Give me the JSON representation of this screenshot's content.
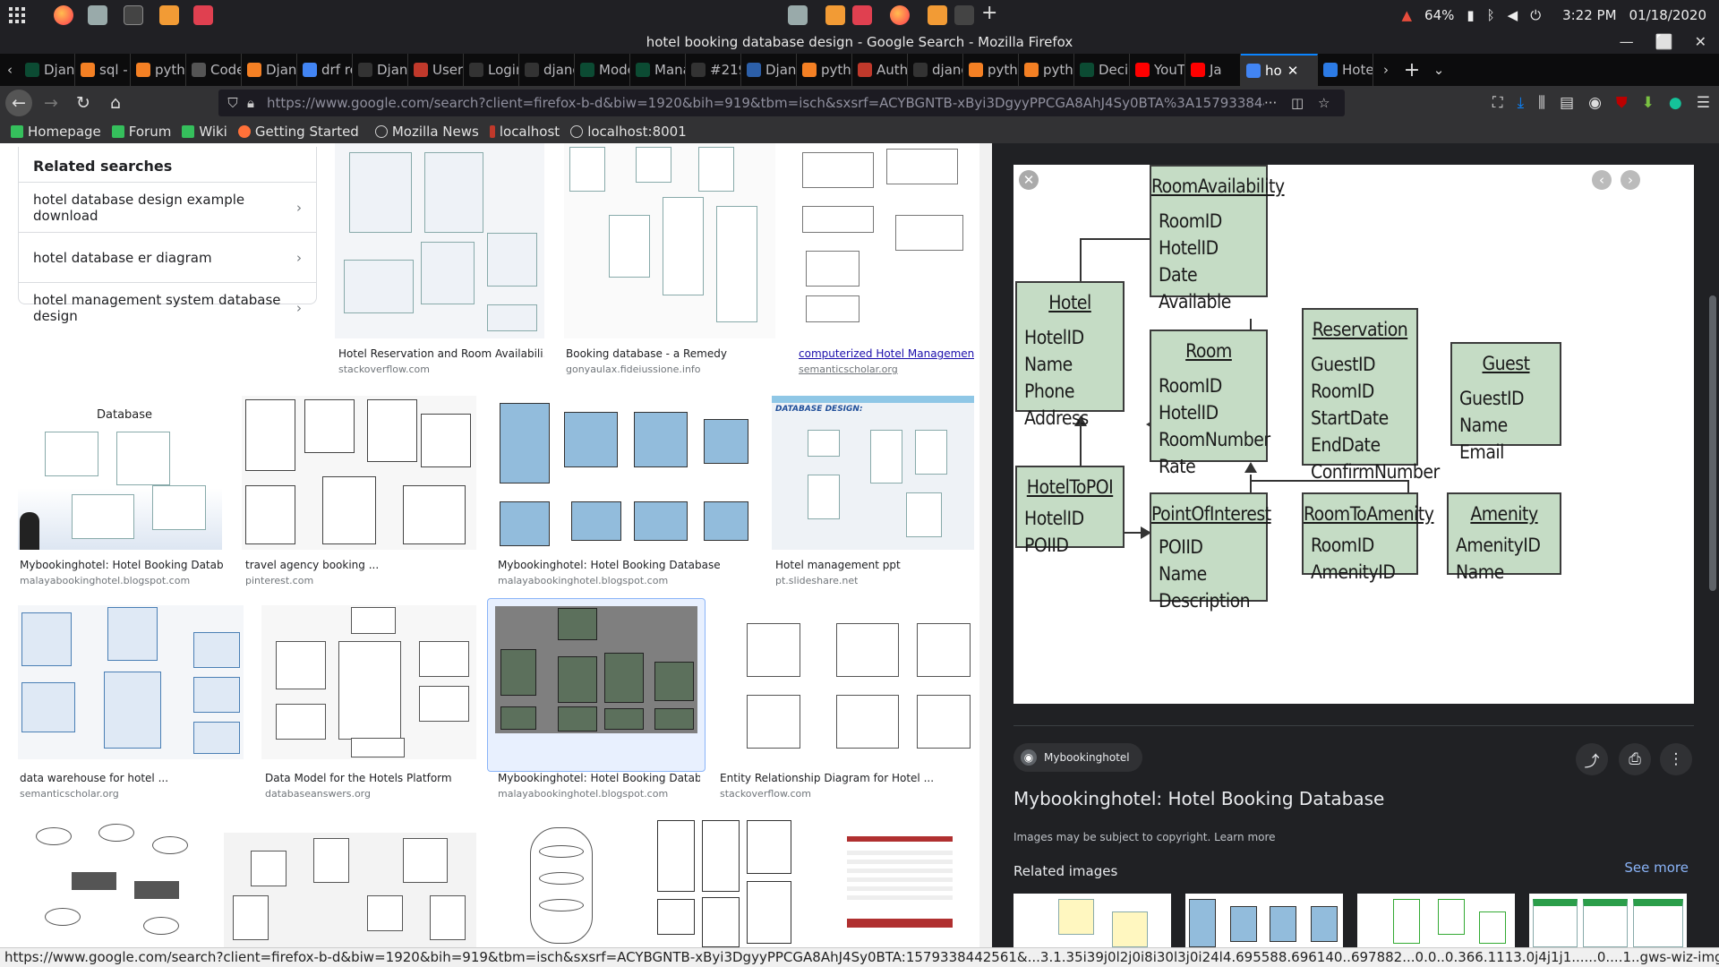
{
  "system": {
    "battery": "64%",
    "time": "3:22 PM",
    "date": "01/18/2020"
  },
  "window": {
    "title": "hotel booking database design - Google Search - Mozilla Firefox"
  },
  "tabs": [
    {
      "label": "Djan",
      "color": "#0c4b33"
    },
    {
      "label": "sql -",
      "color": "#f48024"
    },
    {
      "label": "pytho",
      "color": "#f48024"
    },
    {
      "label": "Code",
      "color": "#555"
    },
    {
      "label": "Djang",
      "color": "#f48024"
    },
    {
      "label": "drf re",
      "color": "#4285f4"
    },
    {
      "label": "Djang",
      "color": "#333"
    },
    {
      "label": "User",
      "color": "#c0392b"
    },
    {
      "label": "Login –",
      "color": "#333"
    },
    {
      "label": "django.c",
      "color": "#333"
    },
    {
      "label": "Mode",
      "color": "#0c4b33"
    },
    {
      "label": "Mana",
      "color": "#0c4b33"
    },
    {
      "label": "#21961",
      "color": "#333"
    },
    {
      "label": "Djang",
      "color": "#2c5fa8"
    },
    {
      "label": "pytho",
      "color": "#f48024"
    },
    {
      "label": "Auth",
      "color": "#c0392b"
    },
    {
      "label": "djang",
      "color": "#333"
    },
    {
      "label": "pytho",
      "color": "#f48024"
    },
    {
      "label": "pytho",
      "color": "#f48024"
    },
    {
      "label": "Deci",
      "color": "#0c4b33"
    },
    {
      "label": "YouT",
      "color": "#ff0000"
    },
    {
      "label": "Ja",
      "color": "#ff0000"
    },
    {
      "label": "ho",
      "color": "#4285f4",
      "active": true
    },
    {
      "label": "Hote",
      "color": "#2c7be5"
    }
  ],
  "url": "https://www.google.com/search?client=firefox-b-d&biw=1920&bih=919&tbm=isch&sxsrf=ACYBGNTB-xByi3DgyyPPCGA8AhJ4Sy0BTA%3A1579338442561&sa",
  "bookmarks": [
    "Homepage",
    "Forum",
    "Wiki",
    "Getting Started",
    "Mozilla News",
    "localhost",
    "localhost:8001"
  ],
  "related_searches": {
    "heading": "Related searches",
    "items": [
      "hotel database design example download",
      "hotel database er diagram",
      "hotel management system database design"
    ]
  },
  "results": [
    {
      "caption": "Hotel Reservation and Room Availabili...",
      "source": "stackoverflow.com"
    },
    {
      "caption": "Booking database - a Remedy",
      "source": "gonyaulax.fideiussione.info"
    },
    {
      "caption": "computerized Hotel Managemen...",
      "source": "semanticscholar.org"
    },
    {
      "caption": "Mybookinghotel: Hotel Booking Datab...",
      "source": "malayabookinghotel.blogspot.com"
    },
    {
      "caption": "travel agency booking ...",
      "source": "pinterest.com"
    },
    {
      "caption": "Mybookinghotel: Hotel Booking Database",
      "source": "malayabookinghotel.blogspot.com"
    },
    {
      "caption": "Hotel management ppt",
      "source": "pt.slideshare.net"
    },
    {
      "caption": "data warehouse for hotel ...",
      "source": "semanticscholar.org"
    },
    {
      "caption": "Data Model for the Hotels Platform",
      "source": "databaseanswers.org"
    },
    {
      "caption": "Mybookinghotel: Hotel Booking Datab...",
      "source": "malayabookinghotel.blogspot.com"
    },
    {
      "caption": "Entity Relationship Diagram for Hotel ...",
      "source": "stackoverflow.com"
    }
  ],
  "thumb_text": {
    "database": "Database",
    "db_design": "DATABASE DESIGN:"
  },
  "preview": {
    "entities": {
      "room_availability": {
        "name": "RoomAvailability",
        "fields": [
          "RoomID",
          "HotelID",
          "Date",
          "Available"
        ]
      },
      "hotel": {
        "name": "Hotel",
        "fields": [
          "HotelID",
          "Name",
          "Phone",
          "Address"
        ]
      },
      "room": {
        "name": "Room",
        "fields": [
          "RoomID",
          "HotelID",
          "RoomNumber",
          "Rate"
        ]
      },
      "reservation": {
        "name": "Reservation",
        "fields": [
          "GuestID",
          "RoomID",
          "StartDate",
          "EndDate",
          "ConfirmNumber"
        ]
      },
      "guest": {
        "name": "Guest",
        "fields": [
          "GuestID",
          "Name",
          "Email"
        ]
      },
      "hotel_to_poi": {
        "name": "HotelToPOI",
        "fields": [
          "HotelID",
          "POIID"
        ]
      },
      "point_of_interest": {
        "name": "PointOfInterest",
        "fields": [
          "POIID",
          "Name",
          "Description"
        ]
      },
      "room_to_amenity": {
        "name": "RoomToAmenity",
        "fields": [
          "RoomID",
          "AmenityID"
        ]
      },
      "amenity": {
        "name": "Amenity",
        "fields": [
          "AmenityID",
          "Name"
        ]
      }
    },
    "source_chip": "Mybookinghotel",
    "title": "Mybookinghotel: Hotel Booking Database",
    "copyright": "Images may be subject to copyright.",
    "learn_more": "Learn more",
    "related_images": "Related images",
    "see_more": "See more"
  },
  "status_url": "https://www.google.com/search?client=firefox-b-d&biw=1920&bih=919&tbm=isch&sxsrf=ACYBGNTB-xByi3DgyyPPCGA8AhJ4Sy0BTA:1579338442561&...3.1.35i39j0l2j0i8i30l3j0i24l4.695588.696140..697882...0.0..0.366.1113.0j4j1j1......0....1..gws-wiz-img.......0i5i30.Yx53mBkJjYM#"
}
